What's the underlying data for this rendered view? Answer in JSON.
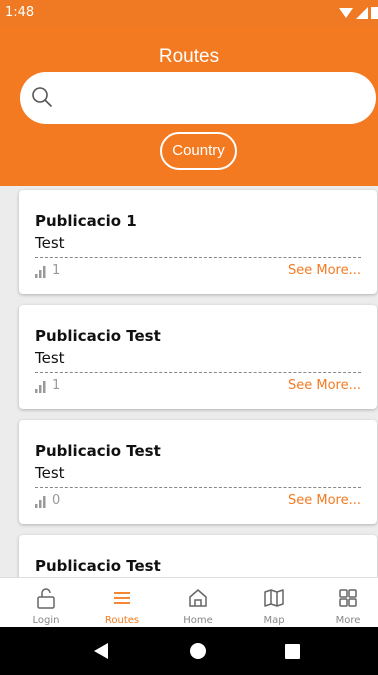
{
  "status_bar": {
    "time": "1:48"
  },
  "header": {
    "title": "Routes",
    "search_placeholder": "",
    "filter_label": "Country"
  },
  "routes": [
    {
      "title": "Publicacio 1",
      "subtitle": "Test",
      "count": "1",
      "more_label": "See More..."
    },
    {
      "title": "Publicacio Test",
      "subtitle": "Test",
      "count": "1",
      "more_label": "See More..."
    },
    {
      "title": "Publicacio Test",
      "subtitle": "Test",
      "count": "0",
      "more_label": "See More..."
    },
    {
      "title": "Publicacio Test",
      "subtitle": "",
      "count": "",
      "more_label": ""
    }
  ],
  "bottom_nav": {
    "items": [
      {
        "label": "Login",
        "icon": "unlock-icon"
      },
      {
        "label": "Routes",
        "icon": "menu-icon",
        "active": true
      },
      {
        "label": "Home",
        "icon": "home-icon"
      },
      {
        "label": "Map",
        "icon": "map-icon"
      },
      {
        "label": "More",
        "icon": "grid-icon"
      }
    ]
  },
  "colors": {
    "accent": "#f47a21",
    "background": "#ececec"
  }
}
